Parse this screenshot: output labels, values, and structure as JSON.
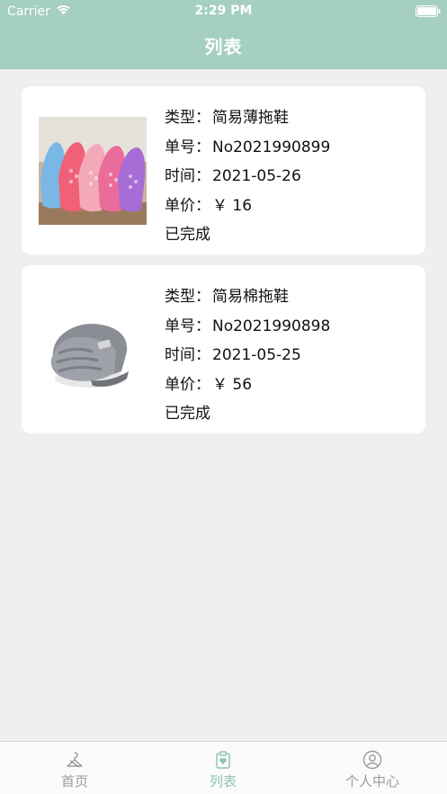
{
  "status_bar": {
    "carrier": "Carrier",
    "time": "2:29 PM",
    "wifi_icon": "wifi-icon",
    "battery_icon": "battery-icon"
  },
  "header": {
    "title": "列表"
  },
  "orders": [
    {
      "image_icon": "slipper-thin-image",
      "type_label": "类型：",
      "type_value": "简易薄拖鞋",
      "number_label": "单号：",
      "number_value": "No2021990899",
      "time_label": "时间：",
      "time_value": "2021-05-26",
      "price_label": "单价：",
      "price_value": "￥ 16",
      "status": "已完成"
    },
    {
      "image_icon": "slipper-cotton-image",
      "type_label": "类型：",
      "type_value": "简易棉拖鞋",
      "number_label": "单号：",
      "number_value": "No2021990898",
      "time_label": "时间：",
      "time_value": "2021-05-25",
      "price_label": "单价：",
      "price_value": "￥ 56",
      "status": "已完成"
    }
  ],
  "tabbar": {
    "items": [
      {
        "label": "首页",
        "icon": "home-hanger-icon"
      },
      {
        "label": "列表",
        "icon": "clipboard-heart-icon"
      },
      {
        "label": "个人中心",
        "icon": "user-circle-icon"
      }
    ],
    "active_index": 1
  },
  "colors": {
    "header": "#a5cfbf",
    "background": "#efefef",
    "tab_active": "#8fc4ae",
    "tab_inactive": "#9a9a9a"
  }
}
